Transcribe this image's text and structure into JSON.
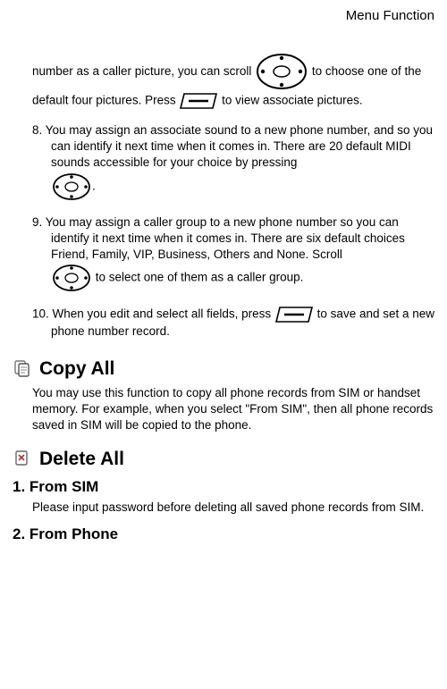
{
  "header": {
    "title": "Menu Function"
  },
  "p7": {
    "t1": "number as a caller picture, you can scroll ",
    "t2": " to choose one of the default four pictures. Press ",
    "t3": " to view associate pictures."
  },
  "p8": {
    "t1": "8. You may assign an associate sound to a new phone number, and so you can identify it next time when it comes in. There are 20 default MIDI sounds accessible for your choice by pressing ",
    "t2": "."
  },
  "p9": {
    "t1": "9. You may assign a caller group to a new phone number so you can identify it next time when it comes in. There are six default choices Friend, Family, VIP, Business, Others and None. Scroll ",
    "t2": " to select one of them as a caller group."
  },
  "p10": {
    "t1": "10. When you edit and select all fields, press ",
    "t2": " to save and set a new phone number record."
  },
  "copyAll": {
    "heading": "Copy All",
    "body": "You may use this function to copy all phone records from SIM or handset memory. For example, when you select \"From SIM\", then all phone records saved in SIM will be copied to the phone."
  },
  "deleteAll": {
    "heading": "Delete All",
    "sub1": {
      "heading": "1. From SIM",
      "body": "Please input password before deleting all saved phone records from SIM."
    },
    "sub2": {
      "heading": "2. From Phone"
    }
  }
}
